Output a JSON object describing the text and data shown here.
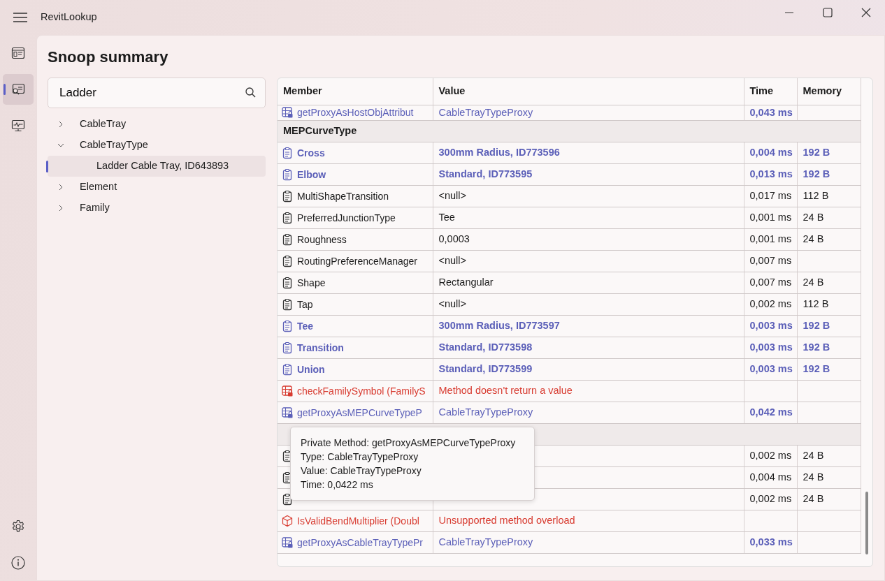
{
  "window": {
    "title": "RevitLookup"
  },
  "nav_items": [
    {
      "selected": false
    },
    {
      "selected": true
    },
    {
      "selected": false
    }
  ],
  "page_title": "Snoop summary",
  "search": {
    "value": "Ladder"
  },
  "tree": [
    {
      "label": "CableTray",
      "expanded": false,
      "selected": false
    },
    {
      "label": "CableTrayType",
      "expanded": true,
      "selected": false,
      "children": [
        {
          "label": "Ladder Cable Tray, ID643893",
          "selected": true
        }
      ]
    },
    {
      "label": "Element",
      "expanded": false,
      "selected": false
    },
    {
      "label": "Family",
      "expanded": false,
      "selected": false
    }
  ],
  "table": {
    "columns": [
      "Member",
      "Value",
      "Time",
      "Memory"
    ],
    "rows": [
      {
        "kind": "private",
        "member": "getProxyAsHostObjAttribut",
        "value": "CableTrayTypeProxy",
        "time": "0,043 ms"
      },
      {
        "kind": "group",
        "label": "MEPCurveType"
      },
      {
        "kind": "link",
        "member": "Cross",
        "value": "300mm Radius, ID773596",
        "time": "0,004 ms",
        "memory": "192 B"
      },
      {
        "kind": "link",
        "member": "Elbow",
        "value": "Standard, ID773595",
        "time": "0,013 ms",
        "memory": "192 B"
      },
      {
        "kind": "plain",
        "member": "MultiShapeTransition",
        "value": "<null>",
        "time": "0,017 ms",
        "memory": "112 B"
      },
      {
        "kind": "plain",
        "member": "PreferredJunctionType",
        "value": "Tee",
        "time": "0,001 ms",
        "memory": "24 B"
      },
      {
        "kind": "plain",
        "member": "Roughness",
        "value": "0,0003",
        "time": "0,001 ms",
        "memory": "24 B"
      },
      {
        "kind": "plain",
        "member": "RoutingPreferenceManager",
        "value": "<null>",
        "time": "0,007 ms"
      },
      {
        "kind": "plain",
        "member": "Shape",
        "value": "Rectangular",
        "time": "0,007 ms",
        "memory": "24 B"
      },
      {
        "kind": "plain",
        "member": "Tap",
        "value": "<null>",
        "time": "0,002 ms",
        "memory": "112 B"
      },
      {
        "kind": "link",
        "member": "Tee",
        "value": "300mm Radius, ID773597",
        "time": "0,003 ms",
        "memory": "192 B"
      },
      {
        "kind": "link",
        "member": "Transition",
        "value": "Standard, ID773598",
        "time": "0,003 ms",
        "memory": "192 B"
      },
      {
        "kind": "link",
        "member": "Union",
        "value": "Standard, ID773599",
        "time": "0,003 ms",
        "memory": "192 B"
      },
      {
        "kind": "error",
        "member": "checkFamilySymbol (FamilyS",
        "value": "Method doesn't return a value"
      },
      {
        "kind": "private",
        "member": "getProxyAsMEPCurveTypeP",
        "value": "CableTrayTypeProxy",
        "time": "0,042 ms"
      },
      {
        "kind": "group"
      },
      {
        "kind": "plain",
        "time": "0,002 ms",
        "memory": "24 B"
      },
      {
        "kind": "plain",
        "time": "0,004 ms",
        "memory": "24 B"
      },
      {
        "kind": "plain",
        "time": "0,002 ms",
        "memory": "24 B"
      },
      {
        "kind": "unsupported",
        "member": "IsValidBendMultiplier (Doubl",
        "value": "Unsupported method overload"
      },
      {
        "kind": "private",
        "member": "getProxyAsCableTrayTypePr",
        "value": "CableTrayTypeProxy",
        "time": "0,033 ms"
      }
    ]
  },
  "tooltip": {
    "lines": [
      "Private Method: getProxyAsMEPCurveTypeProxy",
      "Type: CableTrayTypeProxy",
      "Value: CableTrayTypeProxy",
      "Time: 0,0422 ms"
    ]
  }
}
